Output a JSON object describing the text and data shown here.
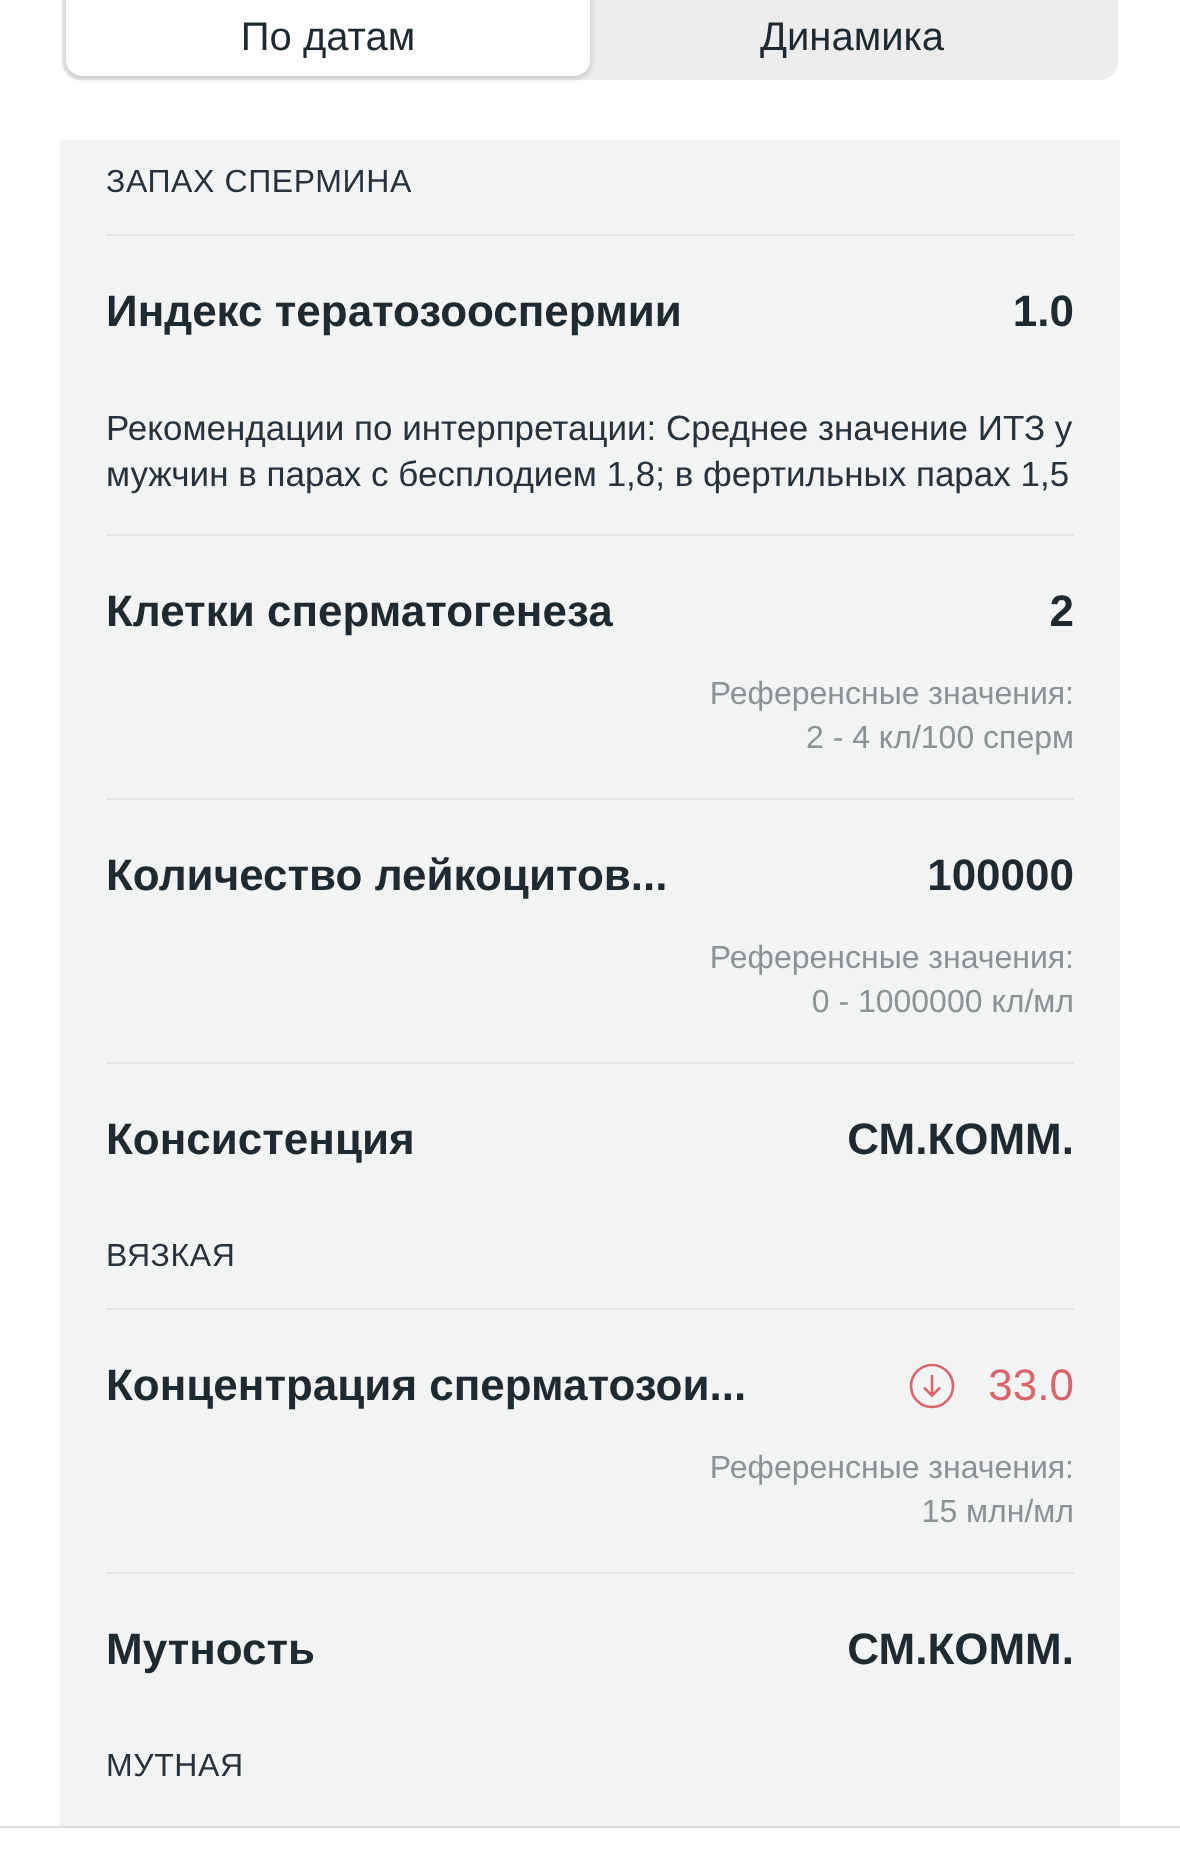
{
  "segments": [
    {
      "label": "По датам",
      "selected": true
    },
    {
      "label": "Динамика",
      "selected": false
    }
  ],
  "items": [
    {
      "kind": "caption",
      "text": "ЗАПАХ СПЕРМИНА"
    },
    {
      "kind": "result",
      "name": "Индекс тератозооспермии",
      "value": "1.0",
      "below_range": false
    },
    {
      "kind": "comment",
      "text": "Рекомендации по интерпретации: Среднее значение ИТЗ у мужчин в парах с бесплодием 1,8; в фертильных парах 1,5"
    },
    {
      "kind": "result",
      "name": "Клетки сперматогенеза",
      "value": "2",
      "below_range": false,
      "reference": [
        "Референсные значения:",
        "2 - 4 кл/100 сперм"
      ]
    },
    {
      "kind": "result",
      "name": "Количество лейкоцитов...",
      "value": "100000",
      "below_range": false,
      "reference": [
        "Референсные значения:",
        "0 - 1000000 кл/мл"
      ]
    },
    {
      "kind": "result",
      "name": "Консистенция",
      "value": "СМ.КОММ.",
      "below_range": false
    },
    {
      "kind": "caption",
      "text": "ВЯЗКАЯ"
    },
    {
      "kind": "result",
      "name": "Концентрация сперматозои...",
      "value": "33.0",
      "below_range": true,
      "reference": [
        "Референсные значения:",
        "15 млн/мл"
      ]
    },
    {
      "kind": "result",
      "name": "Мутность",
      "value": "СМ.КОММ.",
      "below_range": false
    },
    {
      "kind": "caption",
      "text": "МУТНАЯ"
    }
  ]
}
